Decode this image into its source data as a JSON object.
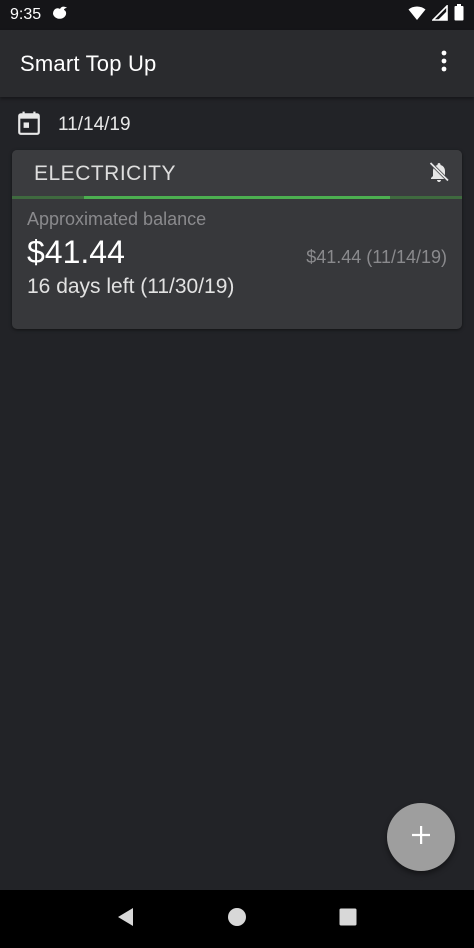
{
  "status_bar": {
    "time": "9:35",
    "icons": [
      "app-notification-icon",
      "wifi-icon",
      "signal-icon",
      "battery-icon"
    ]
  },
  "app_bar": {
    "title": "Smart Top Up",
    "menu_icon": "more-vert-icon"
  },
  "date_row": {
    "icon": "calendar-icon",
    "date": "11/14/19"
  },
  "card": {
    "title": "ELECTRICITY",
    "bell_icon": "notifications-off-icon",
    "balance_label": "Approximated balance",
    "balance_value": "$41.44",
    "balance_secondary": "$41.44 (11/14/19)",
    "days_left": "16 days left (11/30/19)",
    "progress_fraction": 0.68
  },
  "fab": {
    "icon": "plus-icon"
  },
  "nav_bar": {
    "icons": [
      "back-icon",
      "home-icon",
      "recents-icon"
    ]
  },
  "colors": {
    "background": "#222327",
    "app_bar": "#2a2b2e",
    "card": "#37383b",
    "accent_green": "#4caf50",
    "fab": "#9e9e9e"
  }
}
